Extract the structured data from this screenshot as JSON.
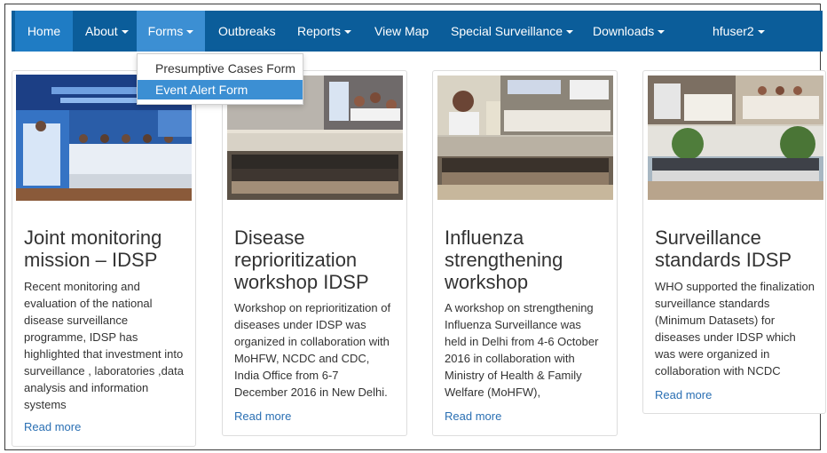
{
  "navbar": {
    "items": [
      {
        "label": "Home"
      },
      {
        "label": "About"
      },
      {
        "label": "Forms"
      },
      {
        "label": "Outbreaks"
      },
      {
        "label": "Reports"
      },
      {
        "label": "View Map"
      },
      {
        "label": "Special Surveillance"
      },
      {
        "label": "Downloads"
      },
      {
        "label": "hfuser2"
      }
    ]
  },
  "forms_dropdown": {
    "items": [
      {
        "label": "Presumptive Cases Form"
      },
      {
        "label": "Event Alert Form"
      }
    ]
  },
  "cards": [
    {
      "title_lines": [
        "Joint monitoring",
        "mission – IDSP"
      ],
      "body_lines": [
        "Recent monitoring and",
        "evaluation of the national",
        "disease surveillance",
        "programme, IDSP has",
        "highlighted that investment into",
        "surveillance , laboratories ,data",
        "analysis and information",
        "systems"
      ],
      "read_more": "Read more"
    },
    {
      "title_lines": [
        "Disease",
        "reprioritization",
        "workshop IDSP"
      ],
      "body_lines": [
        "Workshop on reprioritization of",
        "diseases under IDSP was",
        "organized in collaboration with",
        "MoHFW, NCDC and CDC,",
        "India Office from 6-7",
        "December 2016 in New Delhi."
      ],
      "read_more": "Read more"
    },
    {
      "title_lines": [
        "Influenza",
        "strengthening",
        "workshop"
      ],
      "body_lines": [
        "A workshop on strengthening",
        "Influenza Surveillance was",
        "held in Delhi from 4-6 October",
        "2016 in collaboration with",
        "Ministry of Health & Family",
        "Welfare (MoHFW),"
      ],
      "read_more": "Read more"
    },
    {
      "title_lines": [
        "Surveillance",
        "standards IDSP"
      ],
      "body_lines": [
        "WHO supported the finalization",
        "surveillance standards",
        "(Minimum Datasets) for",
        "diseases under IDSP which",
        "was were organized in",
        "collaboration with NCDC"
      ],
      "read_more": "Read more"
    }
  ]
}
